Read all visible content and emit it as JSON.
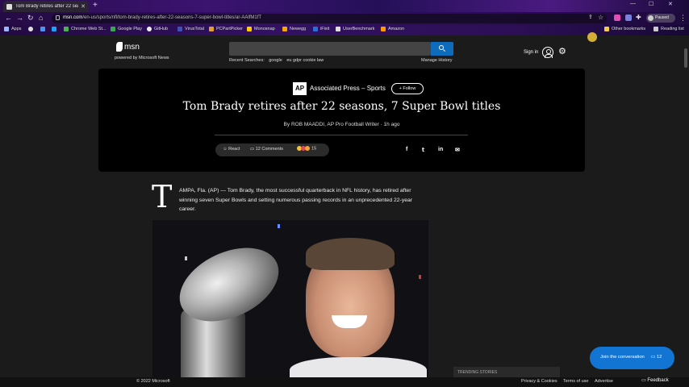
{
  "browser": {
    "tab_title": "Tom Brady retires after 22 seasons, 7...",
    "url_host": "msn.com",
    "url_path": "/en-us/sports/nfl/tom-brady-retires-after-22-seasons-7-super-bowl-titles/ar-AAlfM1fT",
    "profile_status": "Paused",
    "bookmarks": [
      "Apps",
      "Chrome Web St...",
      "Google Play",
      "GitHub",
      "VirusTotal",
      "PCPartPicker",
      "Monosnap",
      "Newegg",
      "iFixit",
      "UserBenchmark",
      "Amazon"
    ],
    "other_bookmarks": "Other bookmarks",
    "reading_list": "Reading list"
  },
  "header": {
    "logo": "msn",
    "powered_by": "powered by Microsoft News",
    "recent_label": "Recent Searches:",
    "recent_searches": [
      "google",
      "eu gdpr cookie law"
    ],
    "manage_history": "Manage History",
    "sign_in": "Sign in"
  },
  "article": {
    "source_logo": "AP",
    "source": "Associated Press – Sports",
    "follow": "Follow",
    "headline": "Tom Brady retires after 22 seasons, 7 Super Bowl titles",
    "byline": "By ROB MAADDI, AP Pro Football Writer · 1h ago",
    "react": "React",
    "comments": "12 Comments",
    "reaction_count": "15",
    "drop_cap": "T",
    "body": "AMPA, Fla. (AP) — Tom Brady, the most successful quarterback in NFL history, has retired after winning seven Super Bowls and setting numerous passing records in an unprecedented 22-year career."
  },
  "sidebar": {
    "trending": "TRENDING STORIES"
  },
  "conversation": {
    "label": "Join the conversation",
    "count": "12"
  },
  "footer": {
    "copyright": "© 2022 Microsoft",
    "links": [
      "Privacy & Cookies",
      "Terms of use",
      "Advertise"
    ],
    "feedback": "Feedback"
  },
  "colors": {
    "accent": "#0f6cbd",
    "join_button": "#1275d3",
    "page_bg": "#1b1b1b",
    "hero_bg": "#000000"
  }
}
